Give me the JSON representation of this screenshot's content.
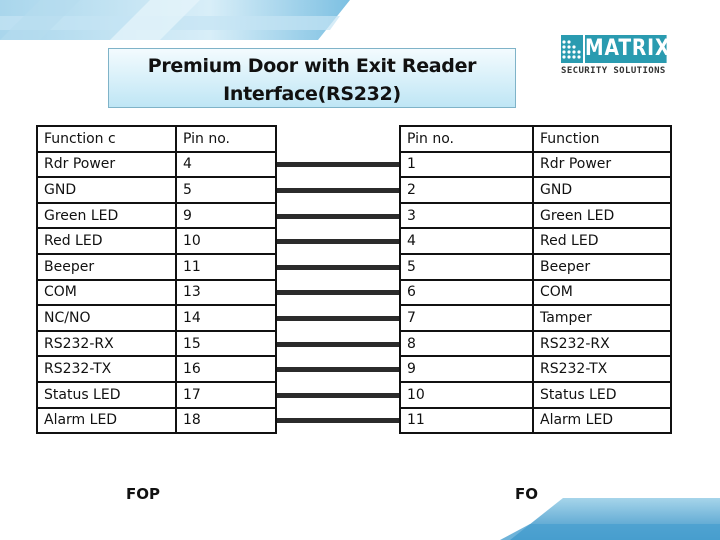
{
  "title": {
    "line1": "Premium Door with Exit Reader",
    "line2": "Interface(RS232)"
  },
  "logo": {
    "icon": "matrix-dots-icon",
    "brand": "MATRIX",
    "tagline": "SECURITY SOLUTIONS",
    "color": "#2a9bb0"
  },
  "left_table": {
    "headers": [
      "Function c",
      "Pin no."
    ],
    "rows": [
      [
        "Rdr Power",
        "4"
      ],
      [
        "GND",
        "5"
      ],
      [
        "Green LED",
        "9"
      ],
      [
        "Red LED",
        "10"
      ],
      [
        "Beeper",
        "11"
      ],
      [
        "COM",
        "13"
      ],
      [
        "NC/NO",
        "14"
      ],
      [
        "RS232-RX",
        "15"
      ],
      [
        "RS232-TX",
        "16"
      ],
      [
        "Status LED",
        "17"
      ],
      [
        "Alarm LED",
        "18"
      ]
    ],
    "label": "FOP"
  },
  "right_table": {
    "headers": [
      "Pin no.",
      "Function"
    ],
    "rows": [
      [
        "1",
        "Rdr Power"
      ],
      [
        "2",
        "GND"
      ],
      [
        "3",
        "Green LED"
      ],
      [
        "4",
        "Red LED"
      ],
      [
        "5",
        "Beeper"
      ],
      [
        "6",
        "COM"
      ],
      [
        "7",
        "Tamper"
      ],
      [
        "8",
        "RS232-RX"
      ],
      [
        "9",
        "RS232-TX"
      ],
      [
        "10",
        "Status LED"
      ],
      [
        "11",
        "Alarm LED"
      ]
    ],
    "label": "FO"
  },
  "connections": [
    [
      "4",
      "1"
    ],
    [
      "5",
      "2"
    ],
    [
      "9",
      "3"
    ],
    [
      "10",
      "4"
    ],
    [
      "11",
      "5"
    ],
    [
      "13",
      "6"
    ],
    [
      "14",
      "7"
    ],
    [
      "15",
      "8"
    ],
    [
      "16",
      "9"
    ],
    [
      "17",
      "10"
    ],
    [
      "18",
      "11"
    ]
  ],
  "colors": {
    "banner": "#8cc9e4",
    "title_box": "#bfe6f5",
    "wire": "#2b2b2b"
  }
}
